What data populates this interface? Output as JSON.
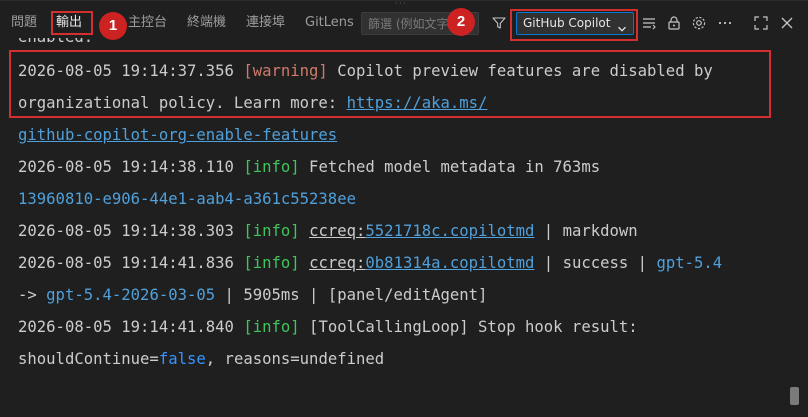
{
  "tabs": [
    {
      "label": "問題"
    },
    {
      "label": "輸出"
    },
    {
      "label": "主控台"
    },
    {
      "label": "終端機"
    },
    {
      "label": "連接埠"
    },
    {
      "label": "GitLens"
    }
  ],
  "filter": {
    "placeholder": "篩選 (例如文字、"
  },
  "channel": {
    "selected": "GitHub Copilot Chat"
  },
  "annotations": {
    "badge1": "1",
    "badge2": "2"
  },
  "colors": {
    "annotation": "#cc2222",
    "warning": "#ce7b6a",
    "info": "#3fc55a",
    "link": "#4fa0db",
    "accent": "#0078d4"
  },
  "toolbar_icons": [
    "filter-icon",
    "list-icon",
    "lock-icon",
    "gear-icon",
    "more-icon",
    "maximize-icon",
    "close-icon"
  ],
  "log": {
    "cut_top": "enabled.",
    "l1": {
      "ts": "2026-08-05 19:14:37.356",
      "level": "[warning]",
      "msg": " Copilot preview features are disabled by"
    },
    "l1b": {
      "text": "organizational policy. Learn more: ",
      "link": "https://aka.ms/"
    },
    "l1c": {
      "link": "github-copilot-org-enable-features"
    },
    "l2": {
      "ts": "2026-08-05 19:14:38.110",
      "level": "[info]",
      "msg": " Fetched model metadata in 763ms"
    },
    "l2b": {
      "id": "13960810-e906-44e1-aab4-a361c55238ee"
    },
    "l3": {
      "ts": "2026-08-05 19:14:38.303",
      "level": "[info]",
      "ccreq": "ccreq:",
      "hash": "5521718c.copilotmd",
      "tail": " | markdown"
    },
    "l4": {
      "ts": "2026-08-05 19:14:41.836",
      "level": "[info]",
      "ccreq": "ccreq:",
      "hash": "0b81314a.copilotmd",
      "mid": " | success | ",
      "model": "gpt-5.4"
    },
    "l4b": {
      "arrow": "-> ",
      "model": "gpt-5.4-2026-03-05",
      "tail": " | 5905ms | [panel/editAgent]"
    },
    "l5": {
      "ts": "2026-08-05 19:14:41.840",
      "level": "[info]",
      "msg": " [ToolCallingLoop] Stop hook result:"
    },
    "l5b": {
      "pre": "shouldContinue=",
      "val": "false",
      "tail": ", reasons=undefined"
    }
  }
}
